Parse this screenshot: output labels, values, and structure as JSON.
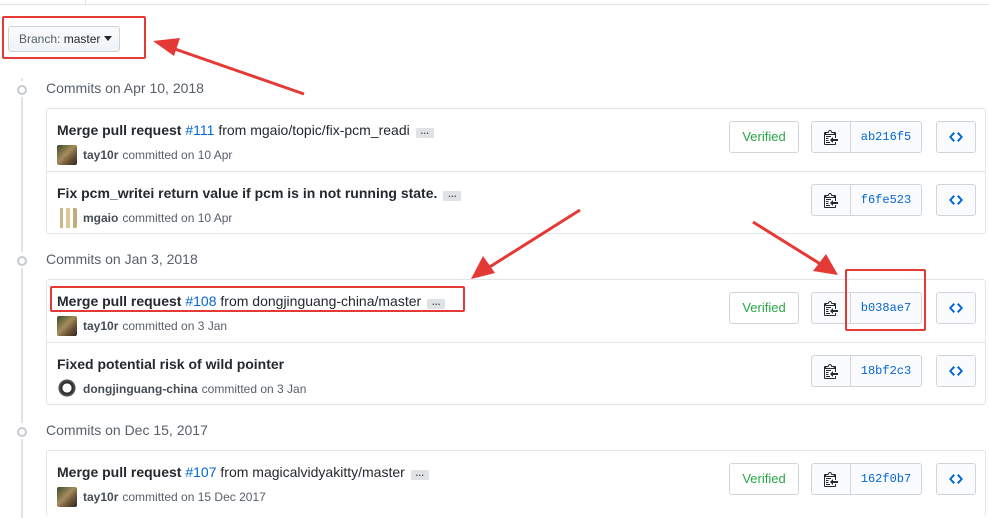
{
  "branch": {
    "label": "Branch:",
    "value": "master"
  },
  "groups": [
    {
      "header": "Commits on Apr 10, 2018",
      "commits": [
        {
          "pre": "Merge pull request ",
          "pr": "#111",
          "post": " from mgaio/topic/fix-pcm_readi",
          "ellipsis": "…",
          "author": "tay10r",
          "action": "committed on 10 Apr",
          "verified": "Verified",
          "sha": "ab216f5"
        },
        {
          "pre": "Fix pcm_writei return value if pcm is in not running state.",
          "pr": "",
          "post": "",
          "ellipsis": "…",
          "author": "mgaio",
          "action": "committed on 10 Apr",
          "verified": "",
          "sha": "f6fe523"
        }
      ]
    },
    {
      "header": "Commits on Jan 3, 2018",
      "commits": [
        {
          "pre": "Merge pull request ",
          "pr": "#108",
          "post": " from dongjinguang-china/master",
          "ellipsis": "…",
          "author": "tay10r",
          "action": "committed on 3 Jan",
          "verified": "Verified",
          "sha": "b038ae7"
        },
        {
          "pre": "Fixed potential risk of wild pointer",
          "pr": "",
          "post": "",
          "ellipsis": "",
          "author": "dongjinguang-china",
          "action": "committed on 3 Jan",
          "verified": "",
          "sha": "18bf2c3"
        }
      ]
    },
    {
      "header": "Commits on Dec 15, 2017",
      "commits": [
        {
          "pre": "Merge pull request ",
          "pr": "#107",
          "post": " from magicalvidyakitty/master",
          "ellipsis": "…",
          "author": "tay10r",
          "action": "committed on 15 Dec 2017",
          "verified": "Verified",
          "sha": "162f0b7"
        }
      ]
    }
  ],
  "icons": {
    "copy": "clipboard-icon",
    "browse": "code-icon",
    "node": "commit-node-icon",
    "caret": "caret-down-icon"
  },
  "colors": {
    "link": "#0366d6",
    "verified": "#28a745",
    "annotation": "#e53935"
  }
}
